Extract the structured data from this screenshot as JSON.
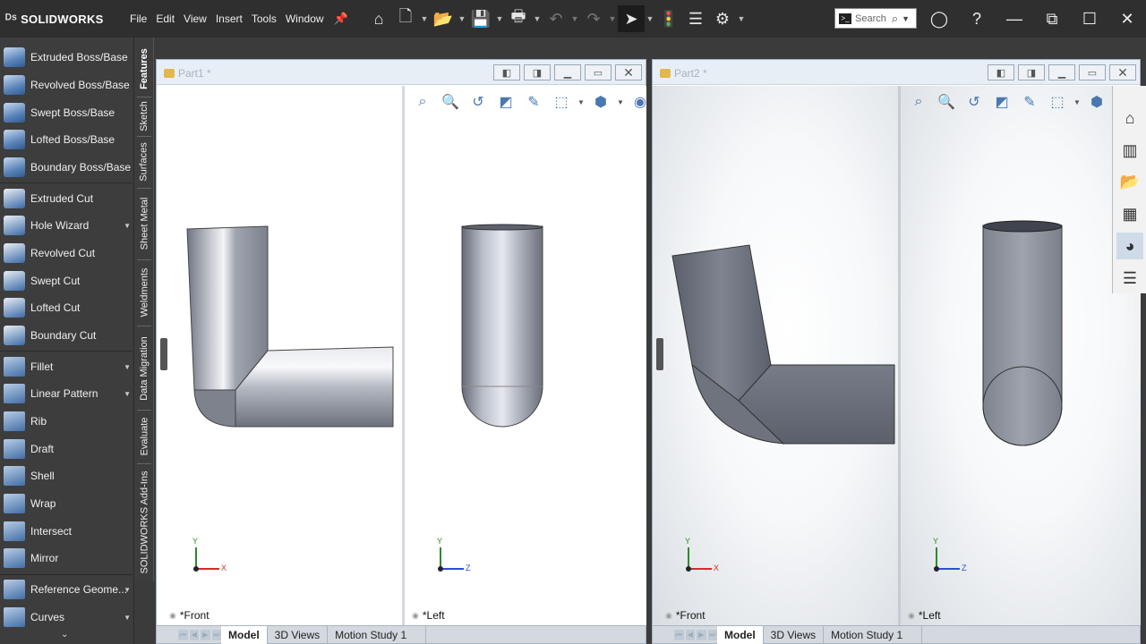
{
  "app": {
    "logo_text": "SOLIDWORKS",
    "menu": [
      "File",
      "Edit",
      "View",
      "Insert",
      "Tools",
      "Window"
    ],
    "search_placeholder": "Search"
  },
  "toolbar_icons": [
    "home-icon",
    "new-document-icon",
    "open-icon",
    "save-icon",
    "print-icon",
    "undo-icon",
    "redo-icon",
    "select-cursor-icon",
    "rebuild-icon",
    "file-properties-icon",
    "options-gear-icon"
  ],
  "command_manager": {
    "items": [
      {
        "label": "Extruded Boss/Base",
        "icon": "extruded-boss-icon",
        "dropdown": false
      },
      {
        "label": "Revolved Boss/Base",
        "icon": "revolved-boss-icon",
        "dropdown": false
      },
      {
        "label": "Swept Boss/Base",
        "icon": "swept-boss-icon",
        "dropdown": false
      },
      {
        "label": "Lofted Boss/Base",
        "icon": "lofted-boss-icon",
        "dropdown": false
      },
      {
        "label": "Boundary Boss/Base",
        "icon": "boundary-boss-icon",
        "dropdown": false
      },
      {
        "label": "Extruded Cut",
        "icon": "extruded-cut-icon",
        "dropdown": false
      },
      {
        "label": "Hole Wizard",
        "icon": "hole-wizard-icon",
        "dropdown": true
      },
      {
        "label": "Revolved Cut",
        "icon": "revolved-cut-icon",
        "dropdown": false
      },
      {
        "label": "Swept Cut",
        "icon": "swept-cut-icon",
        "dropdown": false
      },
      {
        "label": "Lofted Cut",
        "icon": "lofted-cut-icon",
        "dropdown": false
      },
      {
        "label": "Boundary Cut",
        "icon": "boundary-cut-icon",
        "dropdown": false
      },
      {
        "label": "Fillet",
        "icon": "fillet-icon",
        "dropdown": true
      },
      {
        "label": "Linear Pattern",
        "icon": "linear-pattern-icon",
        "dropdown": true
      },
      {
        "label": "Rib",
        "icon": "rib-icon",
        "dropdown": false
      },
      {
        "label": "Draft",
        "icon": "draft-icon",
        "dropdown": false
      },
      {
        "label": "Shell",
        "icon": "shell-icon",
        "dropdown": false
      },
      {
        "label": "Wrap",
        "icon": "wrap-icon",
        "dropdown": false
      },
      {
        "label": "Intersect",
        "icon": "intersect-icon",
        "dropdown": false
      },
      {
        "label": "Mirror",
        "icon": "mirror-icon",
        "dropdown": false
      },
      {
        "label": "Reference Geome...",
        "icon": "reference-geometry-icon",
        "dropdown": true
      },
      {
        "label": "Curves",
        "icon": "curves-icon",
        "dropdown": true
      }
    ]
  },
  "vertical_tabs": [
    {
      "label": "Features",
      "active": true
    },
    {
      "label": "Sketch",
      "active": false
    },
    {
      "label": "Surfaces",
      "active": false
    },
    {
      "label": "Sheet Metal",
      "active": false
    },
    {
      "label": "Weldments",
      "active": false
    },
    {
      "label": "Data Migration",
      "active": false
    },
    {
      "label": "Evaluate",
      "active": false
    },
    {
      "label": "SOLIDWORKS Add-Ins",
      "active": false
    }
  ],
  "documents": [
    {
      "title": "Part1 *",
      "views": [
        {
          "label": "*Front",
          "axis_h": "X",
          "axis_v": "Y"
        },
        {
          "label": "*Left",
          "axis_h": "Z",
          "axis_v": "Y"
        }
      ],
      "tabs": [
        "Model",
        "3D Views",
        "Motion Study 1"
      ],
      "active_tab": "Model"
    },
    {
      "title": "Part2 *",
      "views": [
        {
          "label": "*Front",
          "axis_h": "X",
          "axis_v": "Y"
        },
        {
          "label": "*Left",
          "axis_h": "Z",
          "axis_v": "Y"
        }
      ],
      "tabs": [
        "Model",
        "3D Views",
        "Motion Study 1"
      ],
      "active_tab": "Model"
    }
  ],
  "task_pane_icons": [
    "solidworks-resources-icon",
    "design-library-icon",
    "file-explorer-icon",
    "view-palette-icon",
    "appearances-icon",
    "custom-properties-icon"
  ],
  "colors": {
    "accent": "#4a78b0",
    "topbar": "#2f2f2f",
    "panel": "#3d3d3d"
  }
}
